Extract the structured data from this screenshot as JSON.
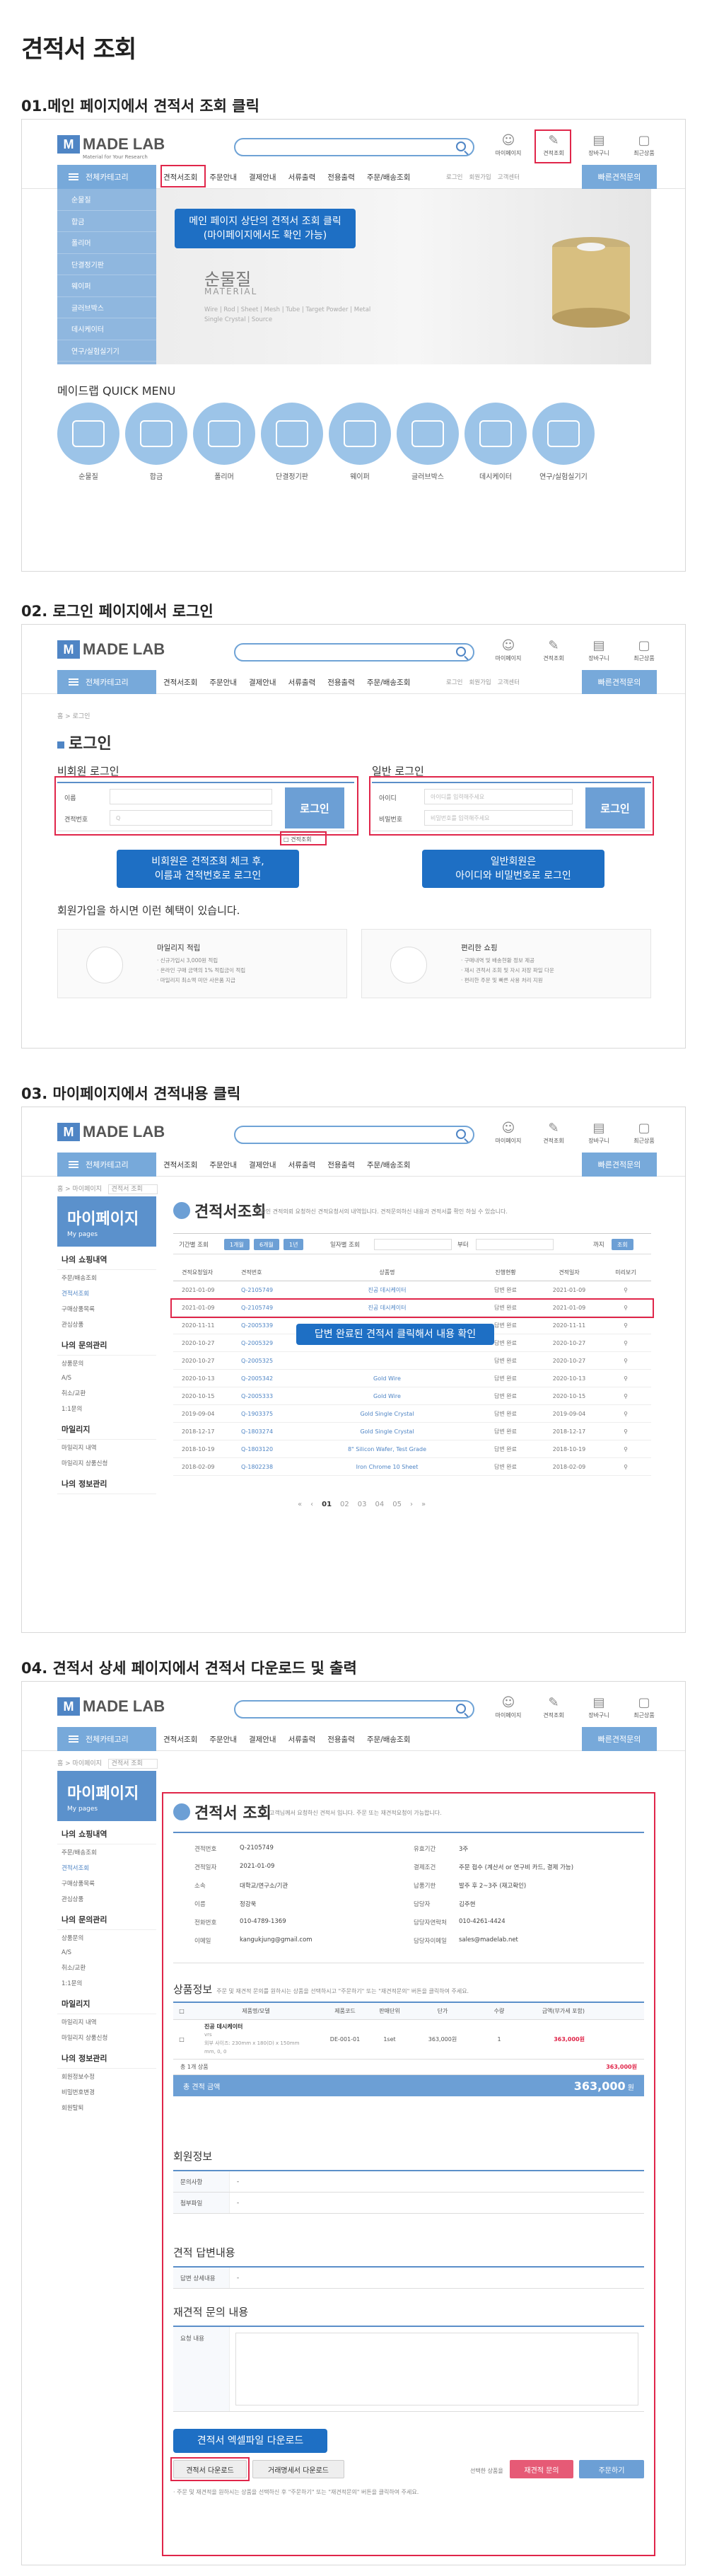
{
  "page": {
    "title": "견적서 조회"
  },
  "common": {
    "logo_mark": "M",
    "logo_text": "MADE LAB",
    "logo_sub": "Material for Your Research",
    "header_icons": [
      {
        "label": "마이페이지",
        "icon": "user-icon"
      },
      {
        "label": "견적조회",
        "icon": "quote-icon"
      },
      {
        "label": "장바구니",
        "icon": "cart-icon"
      },
      {
        "label": "최근상품",
        "icon": "recent-icon"
      }
    ],
    "category_label": "전체카테고리",
    "nav": [
      "견적서조회",
      "주문안내",
      "결제안내",
      "서류출력",
      "전용출력",
      "주문/배송조회"
    ],
    "nav_right": [
      "로그인",
      "회원가입",
      "고객센터"
    ],
    "quote_btn": "빠른견적문의"
  },
  "step1": {
    "title": "01.메인 페이지에서 견적서 조회 클릭",
    "side_categories": [
      "순물질",
      "합금",
      "폴리머",
      "단결정기판",
      "웨이퍼",
      "글러브박스",
      "데시케이터",
      "연구/실험실기기"
    ],
    "banner_title": "순물질",
    "banner_sub": "MATERIAL",
    "banner_desc": "Wire | Rod | Sheet | Mesh | Tube | Target Powder | Metal Single Crystal | Source",
    "callout_line1": "메인 페이지 상단의 견적서 조회 클릭",
    "callout_line2": "(마이페이지에서도 확인 가능)",
    "quick_menu_title": "메이드랩 QUICK MENU",
    "quick_menu": [
      "순물질",
      "합금",
      "폴리머",
      "단결정기판",
      "웨이퍼",
      "글러브박스",
      "데시케이터",
      "연구/실험실기기"
    ]
  },
  "step2": {
    "title": "02. 로그인 페이지에서 로그인",
    "crumb": "홈  >  로그인",
    "login_title": "로그인",
    "guest_title": "비회원 로그인",
    "member_title": "일반 로그인",
    "guest_name": "이름",
    "guest_quote_no": "견적번호",
    "guest_quote_ph": "Q",
    "guest_check": "견적조회",
    "member_id": "아이디",
    "member_id_ph": "아이디를 입력해주세요",
    "member_pw": "비밀번호",
    "member_pw_ph": "비밀번호를 입력해주세요",
    "login_btn": "로그인",
    "guest_callout_1": "비회원은 견적조회 체크 후,",
    "guest_callout_2": "이름과 견적번호로 로그인",
    "member_callout_1": "일반회원은",
    "member_callout_2": "아이디와 비밀번호로 로그인",
    "benefit_title": "회원가입을 하시면 이런 혜택이 있습니다.",
    "benefit1_head": "마일리지 적립",
    "benefit1_lines": [
      "· 신규가입시 3,000원 적립",
      "· 온라인 구매 금액의 1% 적립금이 적립",
      "· 마일리지 최소액 미만 사은품 지급"
    ],
    "benefit2_head": "편리한 쇼핑",
    "benefit2_lines": [
      "· 구매내역 및 배송현황 정보 제공",
      "· 재시 견적서 조회 및 자시 저장 파일 다운",
      "· 편리한 주문 및 빠른 사용 처리 지원"
    ]
  },
  "step3": {
    "title": "03. 마이페이지에서 견적내용 클릭",
    "crumb": "홈  >  마이페이지",
    "crumb_select": "견적서 조회",
    "my_head": "마이페이지",
    "my_head_sub": "My pages",
    "side_sections": [
      {
        "head": "나의 쇼핑내역",
        "links": [
          "주문/배송조회",
          "견적서조회",
          "구매상품목록",
          "관심상품"
        ]
      },
      {
        "head": "나의 문의관리",
        "links": [
          "상품문의",
          "A/S",
          "취소/교환",
          "1:1문의"
        ]
      },
      {
        "head": "마일리지",
        "links": [
          "마일리지 내역",
          "마일리지 상품신청"
        ]
      },
      {
        "head": "나의 정보관리",
        "links": []
      }
    ],
    "page_title": "견적서조회",
    "page_desc": "온라인 견적의뢰 요청하신 견적요청서의 내역입니다. 견적문의하신 내용과 견적서를 확인 하실 수 있습니다.",
    "filter_label1": "기간별 조회",
    "filter_pills": [
      "1개월",
      "6개월",
      "1년"
    ],
    "filter_label2": "일자별 조회",
    "filter_sep": "부터",
    "filter_until": "까지",
    "filter_btn": "조회",
    "table_head": [
      "견적요청일자",
      "견적번호",
      "상품명",
      "진행현황",
      "견적일자",
      "미리보기"
    ],
    "rows": [
      [
        "2021-01-09",
        "Q-2105749",
        "진공 데시케이터",
        "답변 완료",
        "2021-01-09"
      ],
      [
        "2021-01-09",
        "Q-2105749",
        "진공 데시케이터",
        "답변 완료",
        "2021-01-09"
      ],
      [
        "2020-11-11",
        "Q-2005339",
        "",
        "답변 완료",
        "2020-11-11"
      ],
      [
        "2020-10-27",
        "Q-2005329",
        "",
        "답변 완료",
        "2020-10-27"
      ],
      [
        "2020-10-27",
        "Q-2005325",
        "",
        "답변 완료",
        "2020-10-27"
      ],
      [
        "2020-10-13",
        "Q-2005342",
        "Gold Wire",
        "답변 완료",
        "2020-10-13"
      ],
      [
        "2020-10-15",
        "Q-2005333",
        "Gold Wire",
        "답변 완료",
        "2020-10-15"
      ],
      [
        "2019-09-04",
        "Q-1903375",
        "Gold Single Crystal",
        "답변 완료",
        "2019-09-04"
      ],
      [
        "2018-12-17",
        "Q-1803274",
        "Gold Single Crystal",
        "답변 완료",
        "2018-12-17"
      ],
      [
        "2018-10-19",
        "Q-1803120",
        "8\" Silicon Wafer, Test Grade",
        "답변 완료",
        "2018-10-19"
      ],
      [
        "2018-02-09",
        "Q-1802238",
        "Iron Chrome 10 Sheet",
        "답변 완료",
        "2018-02-09"
      ]
    ],
    "callout": "답변 완료된 견적서 클릭해서 내용 확인",
    "pager": [
      "«",
      "‹",
      "01",
      "02",
      "03",
      "04",
      "05",
      "›",
      "»"
    ]
  },
  "step4": {
    "title": "04. 견적서 상세 페이지에서 견적서 다운로드 및 출력",
    "crumb": "홈  >  마이페이지",
    "crumb_select": "견적서 조회",
    "side_sections": [
      {
        "head": "나의 쇼핑내역",
        "links": [
          "주문/배송조회",
          "견적서조회",
          "구매상품목록",
          "관심상품"
        ]
      },
      {
        "head": "나의 문의관리",
        "links": [
          "상품문의",
          "A/S",
          "취소/교환",
          "1:1문의"
        ]
      },
      {
        "head": "마일리지",
        "links": [
          "마일리지 내역",
          "마일리지 상품신청"
        ]
      },
      {
        "head": "나의 정보관리",
        "links": [
          "회원정보수정",
          "비밀번호변경",
          "회원탈퇴"
        ]
      }
    ],
    "detail_title": "견적서 조회",
    "detail_desc": "고객님께서 요청하신 견적서 입니다. 주문 또는 재견적요청이 가능합니다.",
    "info_left": [
      [
        "견적번호",
        "Q-2105749"
      ],
      [
        "견적일자",
        "2021-01-09"
      ],
      [
        "소속",
        "대학교/연구소/기관"
      ],
      [
        "이름",
        "정강욱"
      ],
      [
        "전화번호",
        "010-4789-1369"
      ],
      [
        "이메일",
        "kangukjung@gmail.com"
      ]
    ],
    "info_right": [
      [
        "유효기간",
        "3주"
      ],
      [
        "결제조건",
        "주문 접수 (계산서 or 연구비 카드, 결제 가능)"
      ],
      [
        "납품기한",
        "발주 후 2~3주 (재고확인)"
      ],
      [
        "담당자",
        "김주현"
      ],
      [
        "담당자연락처",
        "010-4261-4424"
      ],
      [
        "담당자이메일",
        "sales@madelab.net"
      ]
    ],
    "product_title": "상품정보",
    "product_note": "주문 및 재견적 문의를 원하시는 상품을 선택하시고 \"주문하기\" 또는 \"재견적문의\" 버튼을 클릭하여 주세요.",
    "product_head": [
      "",
      "제품명/모델",
      "제품코드",
      "판매단위",
      "단가",
      "수량",
      "금액(부가세 포함)"
    ],
    "product_row": {
      "name": "진공 데시케이터",
      "spec1": "vrs",
      "spec2": "외부 사이즈: 230mm x 180(D) x 150mm",
      "spec3": "mm, 0, 0",
      "code": "DE-001-01",
      "unit": "1set",
      "price": "363,000원",
      "qty": "1",
      "amount": "363,000원"
    },
    "count_label": "총 1개 상품",
    "count_amount": "363,000원",
    "total_label": "총 견적 금액",
    "total_value": "363,000",
    "total_unit": "원",
    "member_title": "회원정보",
    "member_rows": [
      [
        "문의사항",
        "-"
      ],
      [
        "첨부파일",
        "-"
      ]
    ],
    "answer_title": "견적 답변내용",
    "answer_rows": [
      [
        "답변 상세내용",
        "-"
      ]
    ],
    "requote_title": "재견적 문의 내용",
    "requote_label": "요청 내용",
    "callout": "견적서 엑셀파일 다운로드",
    "btn_download": "견적서 다운로드",
    "btn_statement": "거래명세서 다운로드",
    "select_note": "선택한 상품을",
    "btn_requote": "재견적 문의",
    "btn_order": "주문하기",
    "footer_note": "· 주문 및 재견적을 원하시는 상품을 선택하신 후 \"주문하기\" 또는 \"재견적문의\" 버튼을 클릭하여 주세요."
  }
}
